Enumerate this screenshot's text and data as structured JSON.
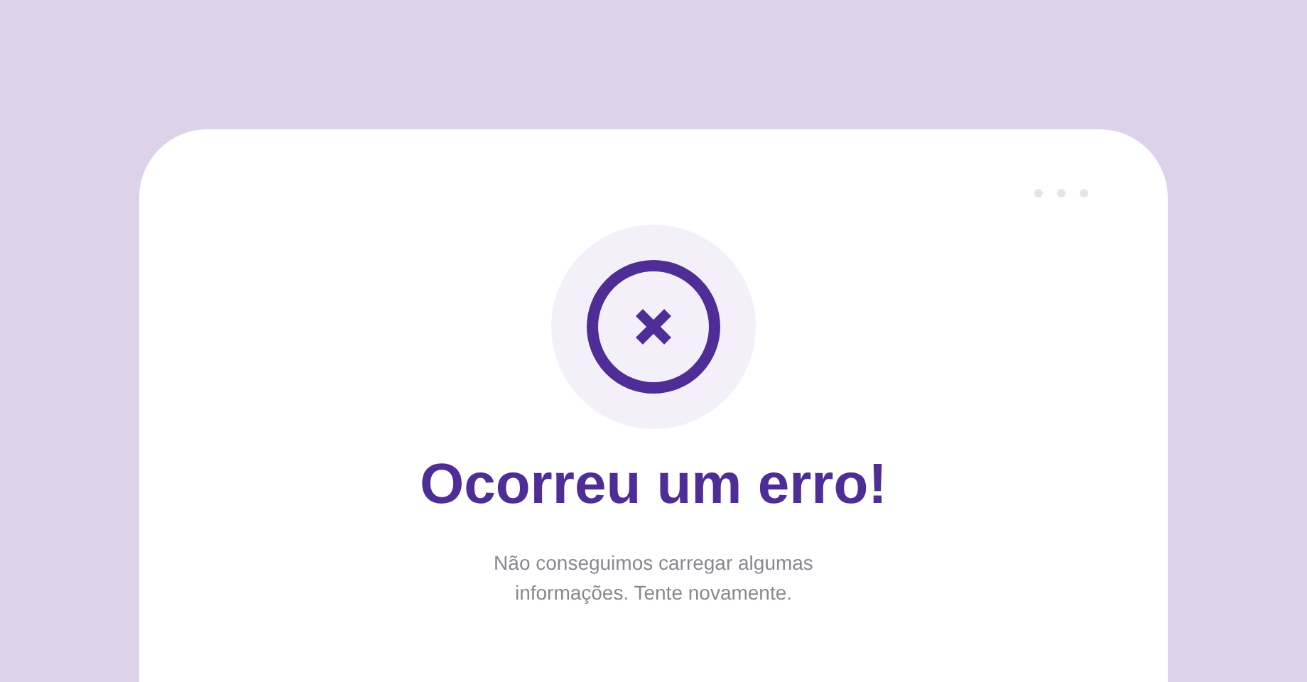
{
  "error": {
    "title": "Ocorreu um erro!",
    "message": "Não conseguimos carregar algumas informações. Tente novamente."
  }
}
